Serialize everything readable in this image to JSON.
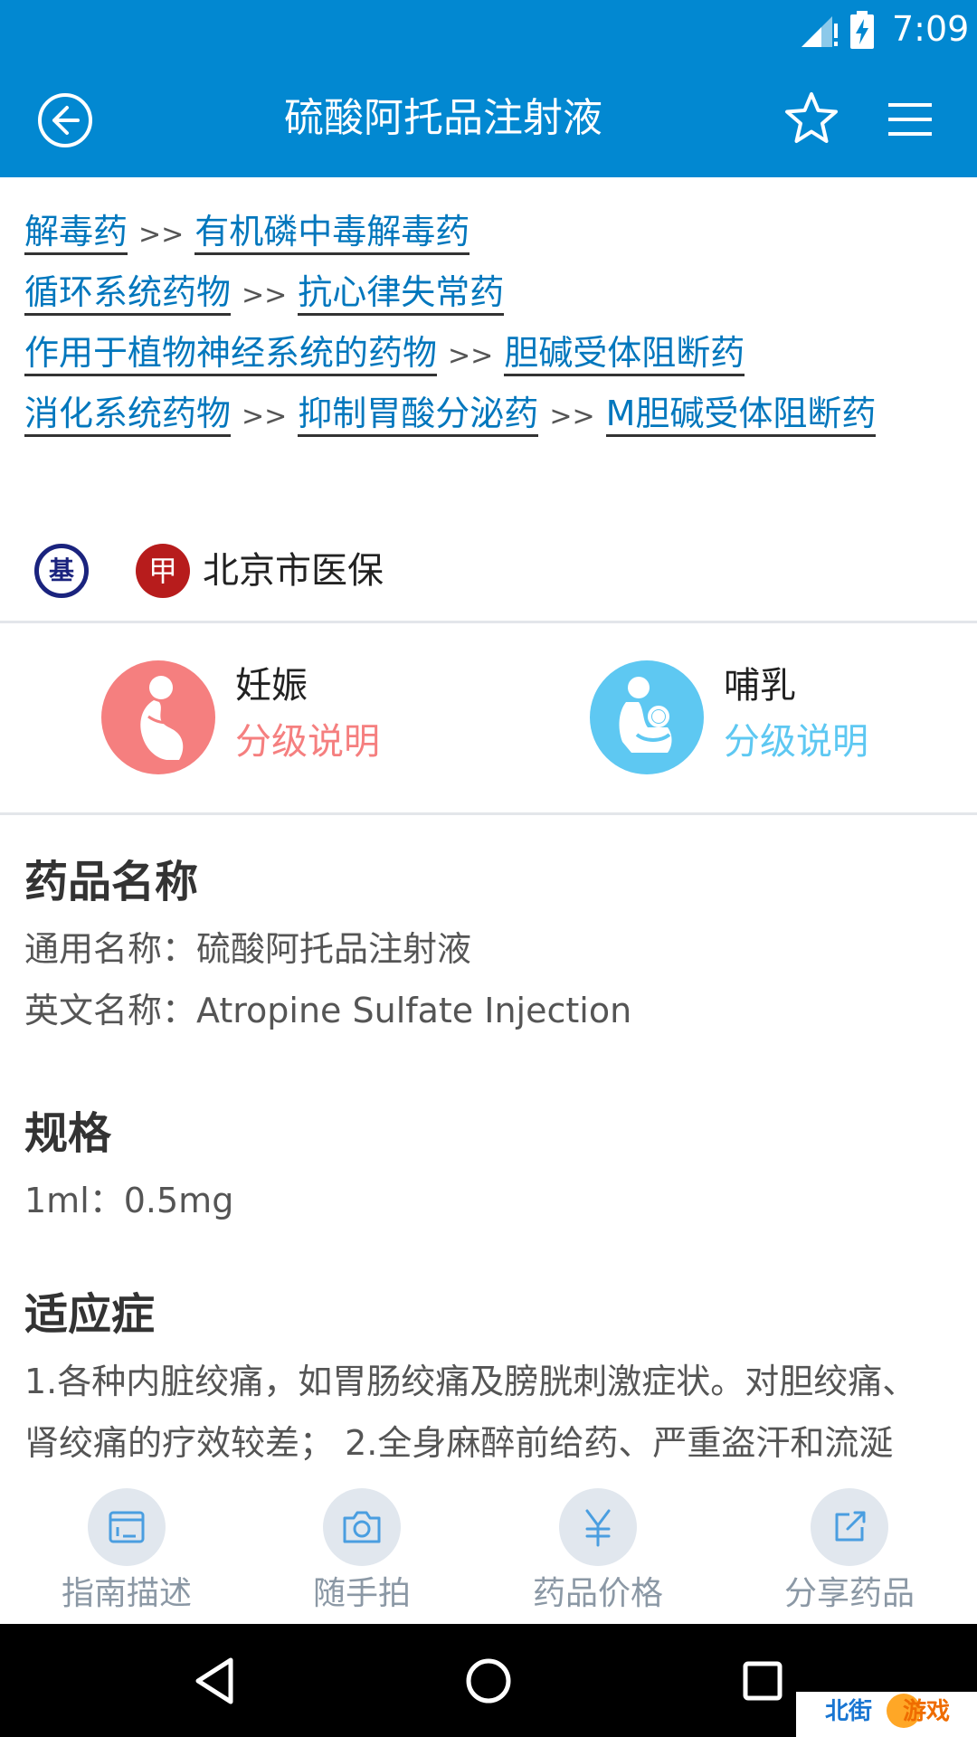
{
  "status_bar": {
    "time": "7:09"
  },
  "app_bar": {
    "title": "硫酸阿托品注射液"
  },
  "breadcrumbs": {
    "separator": ">>",
    "rows": [
      [
        "解毒药",
        "有机磷中毒解毒药"
      ],
      [
        "循环系统药物",
        "抗心律失常药"
      ],
      [
        "作用于植物神经系统的药物",
        "胆碱受体阻断药"
      ],
      [
        "消化系统药物",
        "抑制胃酸分泌药",
        "M胆碱受体阻断药"
      ]
    ]
  },
  "insurance": {
    "basic_badge": "基",
    "class_badge": "甲",
    "label": "北京市医保"
  },
  "grades": {
    "pregnancy": {
      "label": "妊娠",
      "link": "分级说明"
    },
    "lactation": {
      "label": "哺乳",
      "link": "分级说明"
    }
  },
  "drug_name": {
    "heading": "药品名称",
    "generic": "通用名称：硫酸阿托品注射液",
    "english": "英文名称：Atropine Sulfate Injection"
  },
  "specification": {
    "heading": "规格",
    "value": "1ml：0.5mg"
  },
  "indications": {
    "heading": "适应症",
    "line1": "1.各种内脏绞痛，如胃肠绞痛及膀胱刺激症状。对胆绞痛、",
    "line2": "肾绞痛的疗效较差； 2.全身麻醉前给药、严重盗汗和流涎"
  },
  "toolbar": {
    "guide": "指南描述",
    "photo": "随手拍",
    "price": "药品价格",
    "share": "分享药品"
  },
  "watermark": {
    "part1": "北街",
    "part2": "游戏"
  },
  "colors": {
    "primary": "#0288d1",
    "link": "#0277bd",
    "pregnancy": "#f57f7f",
    "lactation": "#5ec8f2",
    "toolbar_label": "#8b98a5"
  }
}
